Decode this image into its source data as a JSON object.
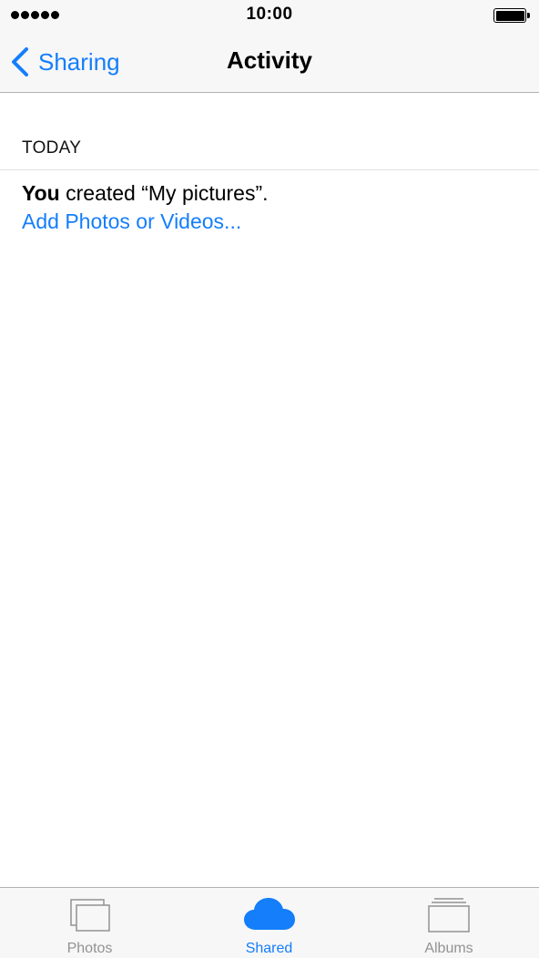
{
  "status_bar": {
    "time": "10:00"
  },
  "nav": {
    "back_label": "Sharing",
    "title": "Activity"
  },
  "content": {
    "section_header": "TODAY",
    "activity_actor": "You",
    "activity_text": " created “My pictures”.",
    "add_link": "Add Photos or Videos..."
  },
  "tabs": [
    {
      "label": "Photos",
      "icon": "photos-icon",
      "active": false
    },
    {
      "label": "Shared",
      "icon": "cloud-icon",
      "active": true
    },
    {
      "label": "Albums",
      "icon": "albums-icon",
      "active": false
    }
  ],
  "colors": {
    "accent": "#147efb",
    "inactive": "#929292",
    "bar_background": "#f7f7f7"
  }
}
